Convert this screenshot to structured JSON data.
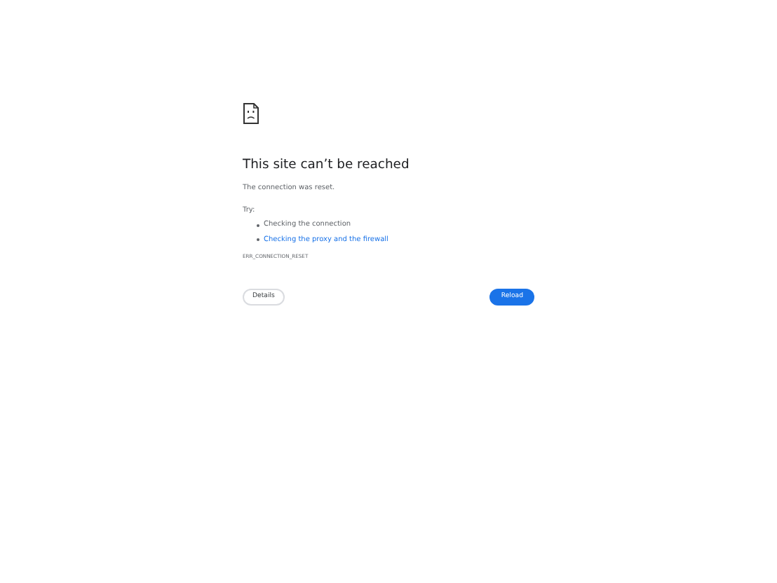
{
  "title": "This site can’t be reached",
  "message": "The connection was reset.",
  "try_label": "Try:",
  "suggestions": [
    {
      "text": "Checking the connection",
      "kind": "text"
    },
    {
      "text": "Checking the proxy and the firewall",
      "kind": "link"
    }
  ],
  "error_code": "ERR_CONNECTION_RESET",
  "buttons": {
    "details": "Details",
    "reload": "Reload"
  }
}
